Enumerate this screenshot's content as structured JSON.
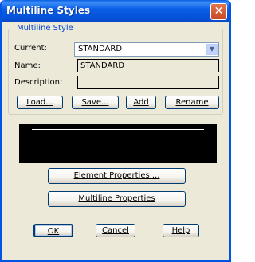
{
  "window": {
    "title": "Multiline Styles"
  },
  "group": {
    "legend": "Multiline Style",
    "current_label": "Current:",
    "current_value": "STANDARD",
    "name_label": "Name:",
    "name_value": "STANDARD",
    "description_label": "Description:",
    "description_value": ""
  },
  "buttons": {
    "load": "Load...",
    "save": "Save...",
    "add": "Add",
    "rename": "Rename",
    "element_properties": "Element Properties ...",
    "multiline_properties": "Multiline Properties",
    "ok": "OK",
    "cancel": "Cancel",
    "help": "Help"
  },
  "colors": {
    "titlebar": "#0a5fe7",
    "legend_text": "#0046d5",
    "dialog_bg": "#ece9d8",
    "preview_bg": "#000000",
    "preview_line": "#ffffff"
  }
}
